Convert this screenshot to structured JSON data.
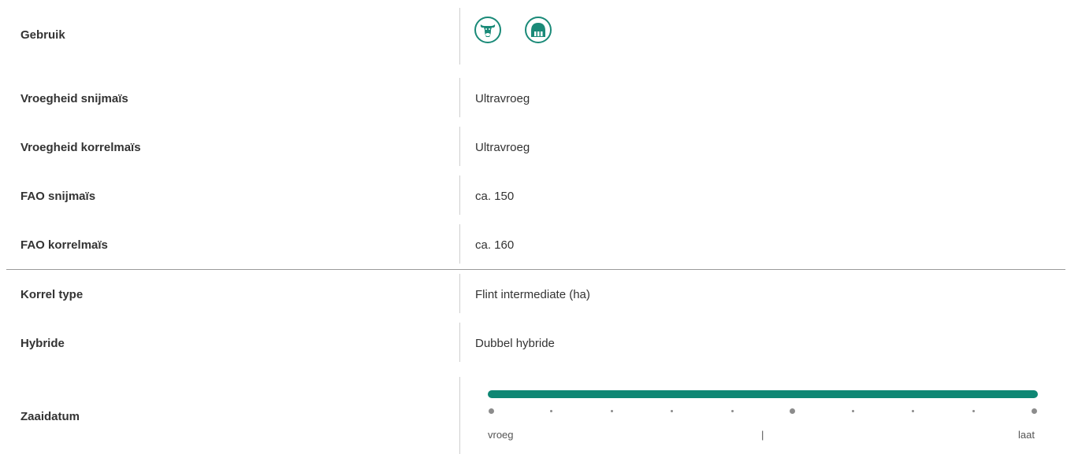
{
  "accent_color": "#0e8774",
  "rows": [
    {
      "label": "Gebruik",
      "icons": [
        "cow-icon",
        "silo-icon"
      ]
    },
    {
      "label": "Vroegheid snijmaïs",
      "value": "Ultravroeg"
    },
    {
      "label": "Vroegheid korrelmaïs",
      "value": "Ultravroeg"
    },
    {
      "label": "FAO snijmaïs",
      "value": "ca. 150"
    },
    {
      "label": "FAO korrelmaïs",
      "value": "ca. 160"
    },
    {
      "label": "Korrel type",
      "value": "Flint intermediate (ha)"
    },
    {
      "label": "Hybride",
      "value": "Dubbel hybride"
    },
    {
      "label": "Zaaidatum"
    }
  ],
  "zaaidatum_scale": {
    "level": 1.0,
    "tick_count": 10,
    "start_label": "vroeg",
    "mid_label": "|",
    "end_label": "laat"
  }
}
